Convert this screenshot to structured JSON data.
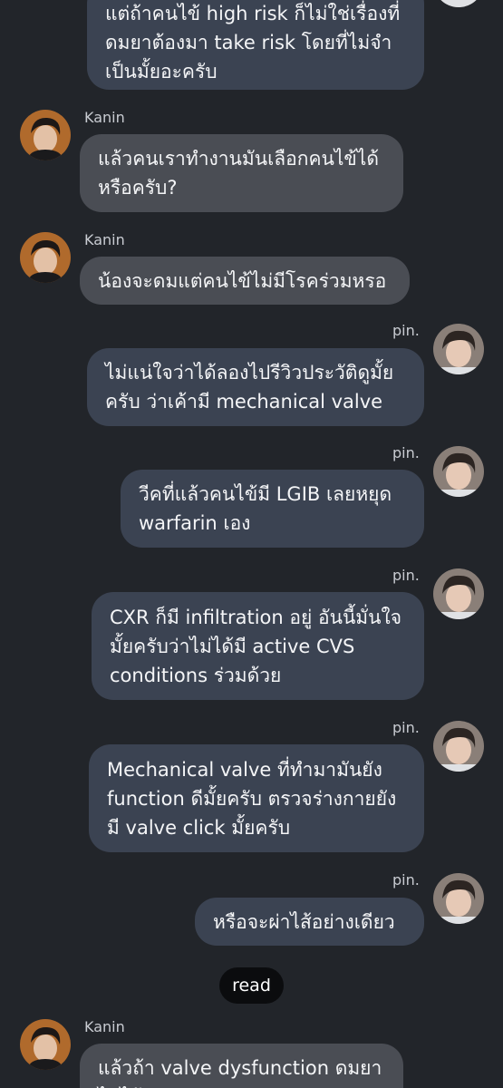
{
  "senders": {
    "kanin": "Kanin",
    "pin": "pin."
  },
  "messages": [
    {
      "id": "m0",
      "text": "แต่ถ้าคนไข้ high risk ก็ไม่ใช่เรื่องที่\nดมยาต้องมา take risk โดยที่ไม่จำ\nเป็นมั้ยอะครับ"
    },
    {
      "id": "m1",
      "text": "แล้วคนเราทำงานมันเลือกคนไข้ได้\nหรือครับ?"
    },
    {
      "id": "m2",
      "text": "น้องจะดมแต่คนไข้ไม่มีโรคร่วมหรอ"
    },
    {
      "id": "m3",
      "text": "ไม่แน่ใจว่าได้ลองไปรีวิวประวัติดูมั้ย\nครับ ว่าเค้ามี mechanical valve"
    },
    {
      "id": "m4",
      "text": "วีคที่แล้วคนไข้มี LGIB เลยหยุด\nwarfarin เอง"
    },
    {
      "id": "m5",
      "text": "CXR ก็มี infiltration อยู่ อันนี้มั่นใจ\nมั้ยครับว่าไม่ได้มี active CVS\nconditions ร่วมด้วย"
    },
    {
      "id": "m6",
      "text": "Mechanical valve ที่ทำมามันยัง\nfunction ดีมั้ยครับ ตรวจร่างกายยัง\nมี valve click มั้ยครับ"
    },
    {
      "id": "m7",
      "text": "หรือจะผ่าไส้อย่างเดียว"
    },
    {
      "id": "m8",
      "text": "แล้วถ้า valve dysfunction ดมยา\nไม่ได้หรอ"
    }
  ],
  "read_label": "read",
  "colors": {
    "background": "#22252a",
    "incoming_bubble": "#4a4d54",
    "outgoing_bubble": "#3b4352",
    "read_badge": "#0b0c0e"
  }
}
